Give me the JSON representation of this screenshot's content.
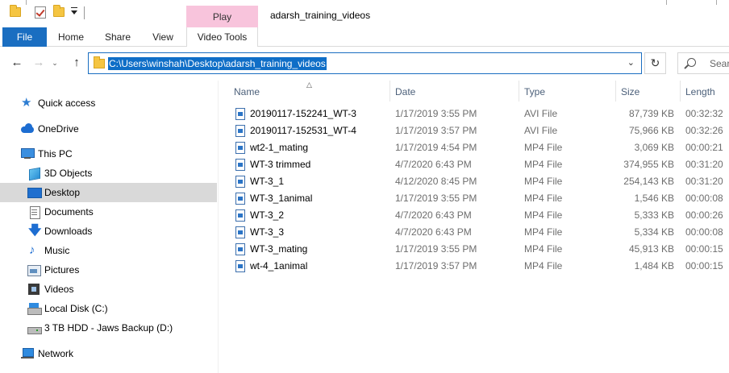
{
  "window": {
    "title": "adarsh_training_videos",
    "context_tab": "Play"
  },
  "ribbon": {
    "tabs": [
      "File",
      "Home",
      "Share",
      "View",
      "Video Tools"
    ]
  },
  "address": {
    "path": "C:\\Users\\winshah\\Desktop\\adarsh_training_videos"
  },
  "search": {
    "placeholder": "Sear"
  },
  "sidebar": {
    "items": [
      {
        "label": "Quick access",
        "icon": "star-icon"
      },
      {
        "label": "OneDrive",
        "icon": "cloud-icon"
      },
      {
        "label": "This PC",
        "icon": "computer-icon"
      },
      {
        "label": "3D Objects",
        "icon": "cube-icon"
      },
      {
        "label": "Desktop",
        "icon": "desktop-icon",
        "selected": true
      },
      {
        "label": "Documents",
        "icon": "document-icon"
      },
      {
        "label": "Downloads",
        "icon": "download-icon"
      },
      {
        "label": "Music",
        "icon": "music-icon"
      },
      {
        "label": "Pictures",
        "icon": "pictures-icon"
      },
      {
        "label": "Videos",
        "icon": "video-icon"
      },
      {
        "label": "Local Disk (C:)",
        "icon": "disk-icon"
      },
      {
        "label": "3 TB HDD - Jaws Backup (D:)",
        "icon": "hdd-icon"
      },
      {
        "label": "Network",
        "icon": "network-icon"
      }
    ]
  },
  "columns": [
    "Name",
    "Date",
    "Type",
    "Size",
    "Length"
  ],
  "files": [
    {
      "name": "20190117-152241_WT-3",
      "date": "1/17/2019 3:55 PM",
      "type": "AVI File",
      "size": "87,739 KB",
      "length": "00:32:32"
    },
    {
      "name": "20190117-152531_WT-4",
      "date": "1/17/2019 3:57 PM",
      "type": "AVI File",
      "size": "75,966 KB",
      "length": "00:32:26"
    },
    {
      "name": "wt2-1_mating",
      "date": "1/17/2019 4:54 PM",
      "type": "MP4 File",
      "size": "3,069 KB",
      "length": "00:00:21"
    },
    {
      "name": "WT-3 trimmed",
      "date": "4/7/2020 6:43 PM",
      "type": "MP4 File",
      "size": "374,955 KB",
      "length": "00:31:20"
    },
    {
      "name": "WT-3_1",
      "date": "4/12/2020 8:45 PM",
      "type": "MP4 File",
      "size": "254,143 KB",
      "length": "00:31:20"
    },
    {
      "name": "WT-3_1animal",
      "date": "1/17/2019 3:55 PM",
      "type": "MP4 File",
      "size": "1,546 KB",
      "length": "00:00:08"
    },
    {
      "name": "WT-3_2",
      "date": "4/7/2020 6:43 PM",
      "type": "MP4 File",
      "size": "5,333 KB",
      "length": "00:00:26"
    },
    {
      "name": "WT-3_3",
      "date": "4/7/2020 6:43 PM",
      "type": "MP4 File",
      "size": "5,334 KB",
      "length": "00:00:08"
    },
    {
      "name": "WT-3_mating",
      "date": "1/17/2019 3:55 PM",
      "type": "MP4 File",
      "size": "45,913 KB",
      "length": "00:00:15"
    },
    {
      "name": "wt-4_1animal",
      "date": "1/17/2019 3:57 PM",
      "type": "MP4 File",
      "size": "1,484 KB",
      "length": "00:00:15"
    }
  ],
  "colors": {
    "accent": "#1a6ec1",
    "context_tab_bg": "#f8c4dc",
    "selection": "#0f6ec7",
    "nav_selected": "#d9d9d9"
  }
}
